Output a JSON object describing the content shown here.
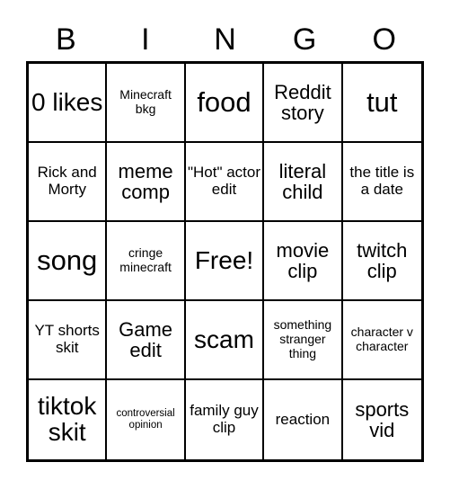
{
  "card": {
    "header_letters": [
      "B",
      "I",
      "N",
      "G",
      "O"
    ],
    "columns": 5,
    "rows": 5,
    "text_color": "#000000",
    "background_color": "#ffffff",
    "border_color": "#000000"
  },
  "cells": [
    {
      "text": "0 likes",
      "size": "lg"
    },
    {
      "text": "Minecraft bkg",
      "size": "xs"
    },
    {
      "text": "food",
      "size": "xl"
    },
    {
      "text": "Reddit story",
      "size": "md"
    },
    {
      "text": "tut",
      "size": "xl"
    },
    {
      "text": "Rick and Morty",
      "size": "sm"
    },
    {
      "text": "meme comp",
      "size": "md"
    },
    {
      "text": "\"Hot\" actor edit",
      "size": "sm"
    },
    {
      "text": "literal child",
      "size": "md"
    },
    {
      "text": "the title is a date",
      "size": "sm"
    },
    {
      "text": "song",
      "size": "xl"
    },
    {
      "text": "cringe minecraft",
      "size": "xs"
    },
    {
      "text": "Free!",
      "size": "lg"
    },
    {
      "text": "movie clip",
      "size": "md"
    },
    {
      "text": "twitch clip",
      "size": "md"
    },
    {
      "text": "YT shorts skit",
      "size": "sm"
    },
    {
      "text": "Game edit",
      "size": "md"
    },
    {
      "text": "scam",
      "size": "lg"
    },
    {
      "text": "something stranger thing",
      "size": "xs"
    },
    {
      "text": "character v character",
      "size": "xs"
    },
    {
      "text": "tiktok skit",
      "size": "lg"
    },
    {
      "text": "controversial opinion",
      "size": "xxs"
    },
    {
      "text": "family guy clip",
      "size": "sm"
    },
    {
      "text": "reaction",
      "size": "sm"
    },
    {
      "text": "sports vid",
      "size": "md"
    }
  ]
}
